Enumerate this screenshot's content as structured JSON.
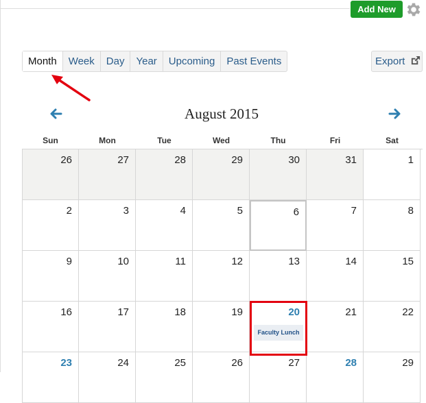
{
  "toolbar": {
    "add_new": "Add New"
  },
  "views": [
    {
      "label": "Month",
      "active": true
    },
    {
      "label": "Week",
      "active": false
    },
    {
      "label": "Day",
      "active": false
    },
    {
      "label": "Year",
      "active": false
    },
    {
      "label": "Upcoming",
      "active": false
    },
    {
      "label": "Past Events",
      "active": false
    }
  ],
  "export_label": "Export",
  "calendar": {
    "title": "August 2015",
    "weekdays": [
      "Sun",
      "Mon",
      "Tue",
      "Wed",
      "Thu",
      "Fri",
      "Sat"
    ],
    "weeks": [
      [
        {
          "n": "26",
          "other": true
        },
        {
          "n": "27",
          "other": true
        },
        {
          "n": "28",
          "other": true
        },
        {
          "n": "29",
          "other": true
        },
        {
          "n": "30",
          "other": true
        },
        {
          "n": "31",
          "other": true
        },
        {
          "n": "1"
        }
      ],
      [
        {
          "n": "2"
        },
        {
          "n": "3"
        },
        {
          "n": "4"
        },
        {
          "n": "5"
        },
        {
          "n": "6",
          "today": true
        },
        {
          "n": "7"
        },
        {
          "n": "8"
        }
      ],
      [
        {
          "n": "9"
        },
        {
          "n": "10"
        },
        {
          "n": "11"
        },
        {
          "n": "12"
        },
        {
          "n": "13"
        },
        {
          "n": "14"
        },
        {
          "n": "15"
        }
      ],
      [
        {
          "n": "16"
        },
        {
          "n": "17"
        },
        {
          "n": "18"
        },
        {
          "n": "19"
        },
        {
          "n": "20",
          "event": "Faculty Lunch"
        },
        {
          "n": "21"
        },
        {
          "n": "22"
        }
      ],
      [
        {
          "n": "23",
          "event": ""
        },
        {
          "n": "24"
        },
        {
          "n": "25"
        },
        {
          "n": "26"
        },
        {
          "n": "27"
        },
        {
          "n": "28",
          "event": ""
        },
        {
          "n": "29"
        }
      ]
    ]
  },
  "colors": {
    "add_new_bg": "#1e9c2b",
    "link": "#2a5c8a",
    "annotation": "#e3000f",
    "event_text": "#1f4f86"
  },
  "icons": {
    "settings": "gear-icon",
    "export": "external-link-icon",
    "prev": "arrow-left-icon",
    "next": "arrow-right-icon"
  }
}
